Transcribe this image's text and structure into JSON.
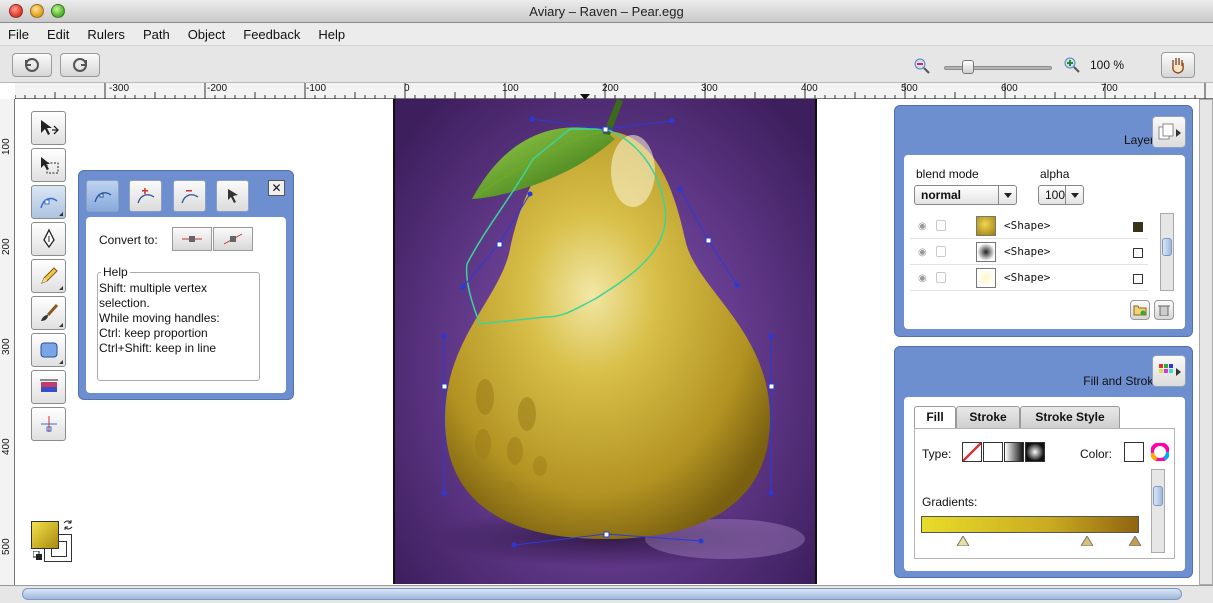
{
  "window": {
    "title": "Aviary – Raven – Pear.egg"
  },
  "menu": [
    "File",
    "Edit",
    "Rulers",
    "Path",
    "Object",
    "Feedback",
    "Help"
  ],
  "toolbar": {
    "zoom_label": "100 %",
    "zoom_fraction": 0.2
  },
  "rulers": {
    "h_ticks": [
      "-300",
      "-200",
      "-100",
      "0",
      "100",
      "200",
      "300",
      "400",
      "500",
      "600",
      "700"
    ],
    "v_ticks": [
      "100",
      "200",
      "300",
      "400",
      "500"
    ]
  },
  "path_panel": {
    "convert_label": "Convert to:",
    "help_legend": "Help",
    "help_text": "Shift: multiple vertex\nselection.\nWhile moving handles:\nCtrl: keep proportion\nCtrl+Shift: keep in line",
    "close_glyph": "✕"
  },
  "layers": {
    "title": "Layers",
    "blend_label": "blend mode",
    "blend_value": "normal",
    "alpha_label": "alpha",
    "alpha_value": "100",
    "rows": [
      {
        "name": "<Shape>",
        "checked": true
      },
      {
        "name": "<Shape>",
        "checked": false
      },
      {
        "name": "<Shape>",
        "checked": false
      }
    ]
  },
  "fill_stroke": {
    "title": "Fill and Stroke",
    "tabs": [
      "Fill",
      "Stroke",
      "Stroke Style"
    ],
    "type_label": "Type:",
    "color_label": "Color:",
    "gradients_label": "Gradients:"
  },
  "colors": {
    "panel_blue": "#6e8fcf",
    "artboard_purple": "#6a3f94",
    "pear_yellow": "#c9ad2e",
    "gradient_start": "#e8dc2a",
    "gradient_end": "#8f6410"
  }
}
